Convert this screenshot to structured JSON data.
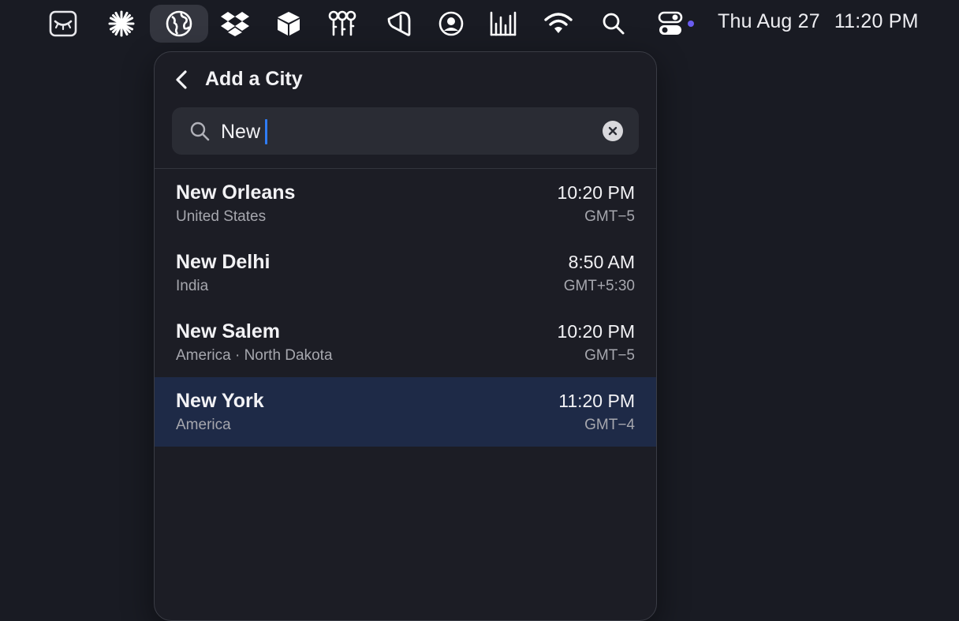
{
  "menubar": {
    "icons": [
      {
        "name": "eye-closed-icon"
      },
      {
        "name": "sparkle-icon"
      },
      {
        "name": "globe-icon",
        "active": true
      },
      {
        "name": "dropbox-icon"
      },
      {
        "name": "cube-icon"
      },
      {
        "name": "keys-icon"
      },
      {
        "name": "bookmark-tag-icon"
      },
      {
        "name": "user-circle-icon"
      },
      {
        "name": "audio-levels-icon"
      },
      {
        "name": "wifi-icon"
      },
      {
        "name": "search-icon"
      },
      {
        "name": "control-center-icon"
      }
    ],
    "date": "Thu Aug 27",
    "time": "11:20 PM"
  },
  "panel": {
    "title": "Add a City",
    "search": {
      "value": "New"
    },
    "results": [
      {
        "city": "New Orleans",
        "region": "United States",
        "time": "10:20 PM",
        "offset": "GMT−5",
        "selected": false
      },
      {
        "city": "New Delhi",
        "region": "India",
        "time": "8:50 AM",
        "offset": "GMT+5:30",
        "selected": false
      },
      {
        "city": "New Salem",
        "region": "America · North Dakota",
        "time": "10:20 PM",
        "offset": "GMT−5",
        "selected": false
      },
      {
        "city": "New York",
        "region": "America",
        "time": "11:20 PM",
        "offset": "GMT−4",
        "selected": true
      }
    ]
  },
  "colors": {
    "background": "#191b23",
    "panel": "#1c1d25",
    "selected_row": "#1e2a47",
    "caret": "#2f7cf6",
    "indicator_dot": "#6a5cf0"
  }
}
